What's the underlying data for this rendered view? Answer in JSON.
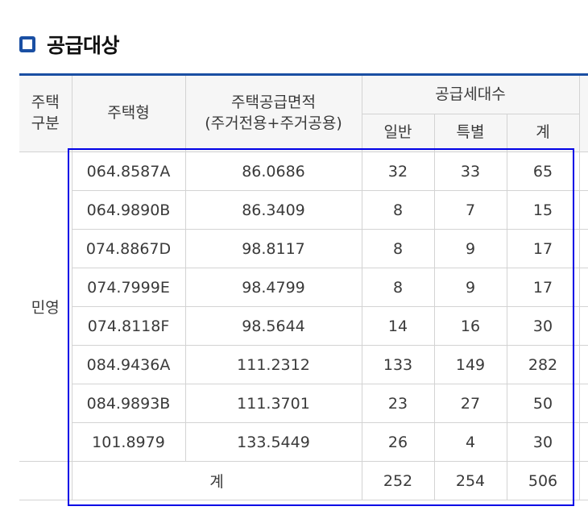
{
  "section": {
    "title": "공급대상"
  },
  "table": {
    "headers": {
      "housing_category_line1": "주택",
      "housing_category_line2": "구분",
      "housing_type": "주택형",
      "supply_area_line1": "주택공급면적",
      "supply_area_line2": "(주거전용+주거공용)",
      "supply_units": "공급세대수",
      "general": "일반",
      "special": "특별",
      "total": "계"
    },
    "category": "민영",
    "rows": [
      {
        "type": "064.8587A",
        "area": "86.0686",
        "general": "32",
        "special": "33",
        "total": "65"
      },
      {
        "type": "064.9890B",
        "area": "86.3409",
        "general": "8",
        "special": "7",
        "total": "15"
      },
      {
        "type": "074.8867D",
        "area": "98.8117",
        "general": "8",
        "special": "9",
        "total": "17"
      },
      {
        "type": "074.7999E",
        "area": "98.4799",
        "general": "8",
        "special": "9",
        "total": "17"
      },
      {
        "type": "074.8118F",
        "area": "98.5644",
        "general": "14",
        "special": "16",
        "total": "30"
      },
      {
        "type": "084.9436A",
        "area": "111.2312",
        "general": "133",
        "special": "149",
        "total": "282"
      },
      {
        "type": "084.9893B",
        "area": "111.3701",
        "general": "23",
        "special": "27",
        "total": "50"
      },
      {
        "type": "101.8979",
        "area": "133.5449",
        "general": "26",
        "special": "4",
        "total": "30"
      }
    ],
    "totals": {
      "label": "계",
      "general": "252",
      "special": "254",
      "total": "506"
    }
  },
  "colors": {
    "accent": "#1a4fa3",
    "highlight": "#0000e6",
    "header_bg": "#f6f6f6",
    "border": "#d3d3d3"
  }
}
